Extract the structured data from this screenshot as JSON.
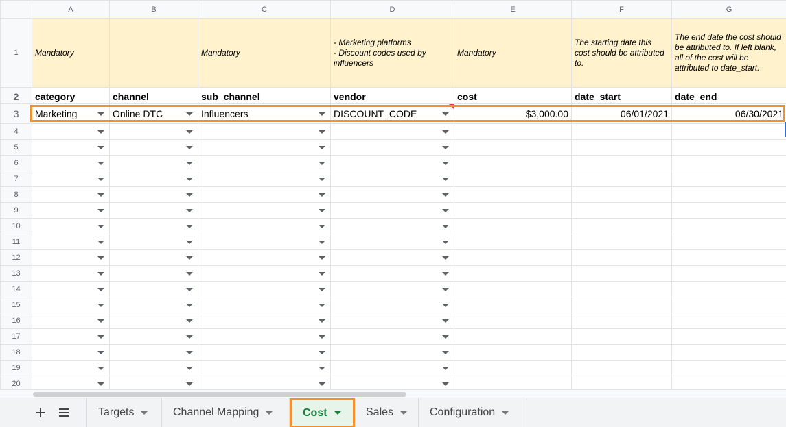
{
  "columns": [
    "A",
    "B",
    "C",
    "D",
    "E",
    "F",
    "G"
  ],
  "notes": {
    "A": "Mandatory",
    "B": "",
    "C": "Mandatory",
    "D": "- Marketing platforms\n- Discount codes used by influencers",
    "E": "Mandatory",
    "F": "The starting date this cost should be attributed to.",
    "G": "The end date the cost should be attributed to. If left blank, all of the cost will be attributed to date_start."
  },
  "headers": {
    "A": "category",
    "B": "channel",
    "C": "sub_channel",
    "D": "vendor",
    "E": "cost",
    "F": "date_start",
    "G": "date_end"
  },
  "row3": {
    "A": "Marketing",
    "B": "Online DTC",
    "C": "Influencers",
    "D": "DISCOUNT_CODE",
    "E": "$3,000.00",
    "F": "06/01/2021",
    "G": "06/30/2021"
  },
  "row_numbers": [
    "1",
    "2",
    "3",
    "4",
    "5",
    "6",
    "7",
    "8",
    "9",
    "10",
    "11",
    "12",
    "13",
    "14",
    "15",
    "16",
    "17",
    "18",
    "19",
    "20"
  ],
  "tabs": [
    {
      "label": "Targets",
      "active": false
    },
    {
      "label": "Channel Mapping",
      "active": false
    },
    {
      "label": "Cost",
      "active": true
    },
    {
      "label": "Sales",
      "active": false
    },
    {
      "label": "Configuration",
      "active": false
    }
  ],
  "icons": {
    "add_sheet": "plus-icon",
    "all_sheets": "list-icon"
  },
  "colors": {
    "note_fill": "#fff2cc",
    "highlight": "#f4902b",
    "active_tab": "#188038"
  }
}
